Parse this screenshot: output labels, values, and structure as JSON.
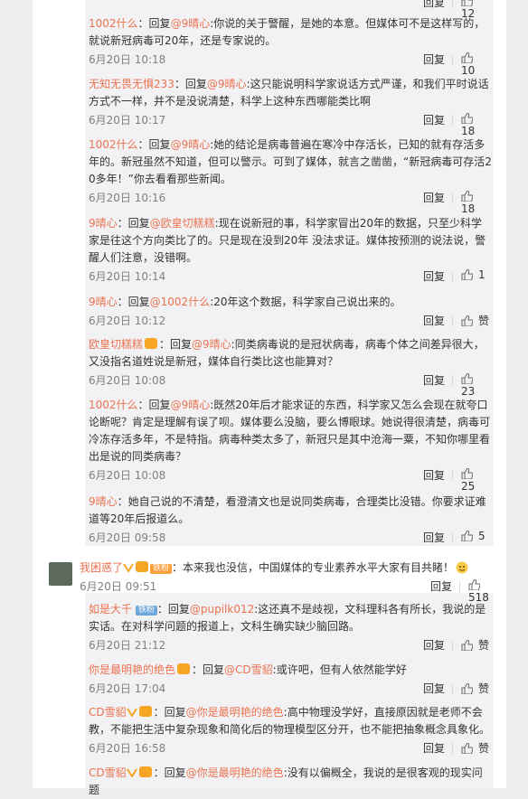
{
  "top_partial": {
    "time": "",
    "like_count": "12"
  },
  "replies": [
    {
      "user": "1002什么",
      "reply_prefix": "：回复",
      "at": "@9晴心",
      "text": ":你说的关于警醒，是她的本意。但媒体可不是这样写的，就说新冠病毒可20年，还是专家说的。",
      "time": "6月20日 10:18",
      "reply_label": "回复",
      "likes": "10"
    },
    {
      "user": "无知无畏无惧233",
      "reply_prefix": "：回复",
      "at": "@9晴心",
      "text": ":这只能说明科学家说话方式严谨，和我们平时说话方式不一样，并不是没说清楚，科学上这种东西哪能类比啊",
      "time": "6月20日 10:17",
      "reply_label": "回复",
      "likes": "18"
    },
    {
      "user": "1002什么",
      "reply_prefix": "：回复",
      "at": "@9晴心",
      "text": ":她的结论是病毒普遍在寒冷中存活长，已知的就有存活多年的。新冠虽然不知道，但可以警示。可到了媒体，就言之凿凿，“新冠病毒可存活20多年！”你去看看那些新闻。",
      "time": "6月20日 10:16",
      "reply_label": "回复",
      "likes": "18"
    },
    {
      "user": "9晴心",
      "reply_prefix": "：回复",
      "at": "@欧皇切糕糕",
      "text": ":现在说新冠的事，科学家冒出20年的数据，只至少科学家是往这个方向类比了的。只是现在没到20年 没法求证。媒体按预测的说法说，警醒人们注意，没错啊。",
      "time": "6月20日 10:14",
      "reply_label": "回复",
      "likes": "1"
    },
    {
      "user": "9晴心",
      "reply_prefix": "：回复",
      "at": "@1002什么",
      "text": ":20年这个数据，科学家自己说出来的。",
      "time": "6月20日 10:12",
      "reply_label": "回复",
      "likes": "赞"
    },
    {
      "user": "欧皇切糕糕",
      "reply_prefix": "：回复",
      "at": "@9晴心",
      "text": ":同类病毒说的是冠状病毒，病毒个体之间差异很大，又没指名道姓说是新冠，媒体自行类比这也能算对？",
      "time": "6月20日 10:08",
      "reply_label": "回复",
      "likes": "23"
    },
    {
      "user": "1002什么",
      "reply_prefix": "：回复",
      "at": "@9晴心",
      "text": ":既然20年后才能求证的东西，科学家又怎么会现在就夸口论断呢？肯定是理解有误了呗。媒体要么没脑，要么博眼球。她说得很清楚，病毒可冷冻存活多年，不是特指。病毒种类太多了，新冠只是其中沧海一粟，不知你哪里看出是说的同类病毒？",
      "time": "6月20日 10:08",
      "reply_label": "回复",
      "likes": "25"
    },
    {
      "user": "9晴心",
      "reply_prefix": "：",
      "at": "",
      "text": "她自己说的不清楚，看澄清文也是说同类病毒，合理类比没错。你要求证难道等20年后报道么。",
      "time": "6月20日 09:58",
      "reply_label": "回复",
      "likes": "5"
    }
  ],
  "main_comment": {
    "user": "我困惑了",
    "tag": "铁粉",
    "text": "：本来我也没信，中国媒体的专业素养水平大家有目共睹！",
    "time": "6月20日 09:51",
    "reply_label": "回复",
    "likes": "518"
  },
  "replies2": [
    {
      "user": "如是大千",
      "tag": "铁粉",
      "reply_prefix": "：回复",
      "at": "@pupilk012",
      "text": ":这还真不是歧视，文科理科各有所长，我说的是实话。在对科学问题的报道上，文科生确实缺少脑回路。",
      "time": "6月20日 21:12",
      "reply_label": "回复",
      "likes": "赞"
    },
    {
      "user": "你是最明艳的绝色",
      "reply_prefix": "：回复",
      "at": "@CD雪貂",
      "text": ":或许吧，但有人依然能学好",
      "time": "6月20日 17:04",
      "reply_label": "回复",
      "likes": "赞"
    },
    {
      "user": "CD雪貂",
      "reply_prefix": "：回复",
      "at": "@你是最明艳的绝色",
      "text": ":高中物理没学好，直接原因就是老师不会教，不能把生活中复杂现象和简化后的物理模型区分开，也不能把抽象概念具象化。",
      "time": "6月20日 16:58",
      "reply_label": "回复",
      "likes": "赞"
    },
    {
      "user": "CD雪貂",
      "reply_prefix": "：回复",
      "at": "@你是最明艳的绝色",
      "text": ":没有以偏概全，我说的是很客观的现实问题",
      "time": "",
      "reply_label": "",
      "likes": ""
    }
  ]
}
